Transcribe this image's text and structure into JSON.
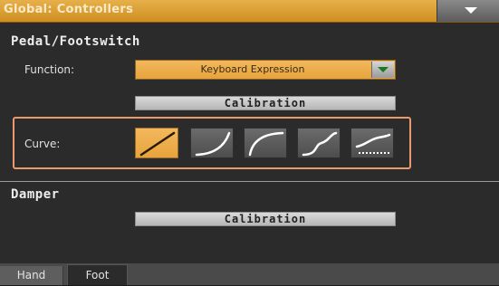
{
  "window": {
    "title": "Global: Controllers"
  },
  "pedal": {
    "section_title": "Pedal/Footswitch",
    "function_label": "Function:",
    "function_value": "Keyboard Expression",
    "calibration_label": "Calibration",
    "curve_label": "Curve:",
    "curves": [
      {
        "icon": "linear-curve-icon",
        "selected": true
      },
      {
        "icon": "exponential-curve-icon",
        "selected": false
      },
      {
        "icon": "logarithmic-curve-icon",
        "selected": false
      },
      {
        "icon": "s-curve-icon",
        "selected": false
      },
      {
        "icon": "dotted-curve-icon",
        "selected": false
      }
    ]
  },
  "damper": {
    "section_title": "Damper",
    "calibration_label": "Calibration"
  },
  "tabs": [
    {
      "label": "Hand",
      "active": false
    },
    {
      "label": "Foot",
      "active": true
    }
  ],
  "colors": {
    "accent": "#e7a43d",
    "frame_highlight": "#e89a6e"
  }
}
